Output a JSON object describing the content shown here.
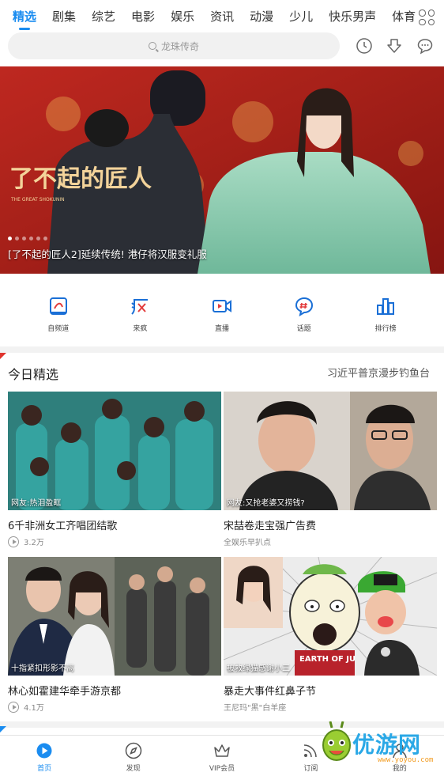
{
  "tabs": [
    "精选",
    "剧集",
    "综艺",
    "电影",
    "娱乐",
    "资讯",
    "动漫",
    "少儿",
    "快乐男声",
    "体育"
  ],
  "search": {
    "placeholder": "龙珠传奇"
  },
  "banner": {
    "caption": "[了不起的匠人2]延续传统! 港仔将汉服变礼服",
    "logo_text": "了不起的匠人",
    "logo_sub": "THE GREAT SHOKUNIN"
  },
  "quick_nav": [
    "自频道",
    "来疯",
    "直播",
    "话题",
    "排行榜"
  ],
  "section": {
    "title": "今日精选",
    "more": "习近平普京漫步钓鱼台"
  },
  "cards": [
    {
      "tag": "网友:热泪盈眶",
      "title": "6千非洲女工齐唱团结歌",
      "meta": "3.2万",
      "meta_type": "plays"
    },
    {
      "tag": "网友:又抢老婆又捞钱?",
      "title": "宋喆卷走宝强广告费",
      "meta": "全娱乐早扒点",
      "meta_type": "source"
    },
    {
      "tag": "十指紧扣形影不离",
      "title": "林心如霍建华牵手游京都",
      "meta": "4.1万",
      "meta_type": "plays"
    },
    {
      "tag": "被救绿猫感谢小三",
      "title": "暴走大事件红鼻子节",
      "meta": "王尼玛\"黑\"白羊座",
      "meta_type": "source",
      "image_text": "EARTH OF JU"
    }
  ],
  "bottom_nav": [
    "首页",
    "发现",
    "VIP会员",
    "订阅",
    "我的"
  ],
  "watermark": {
    "text": "优游网",
    "sub": "www.yoyou.com"
  },
  "colors": {
    "accent": "#1a8cf0",
    "banner_red": "#b3211b",
    "divider": "#f2f2f2"
  }
}
